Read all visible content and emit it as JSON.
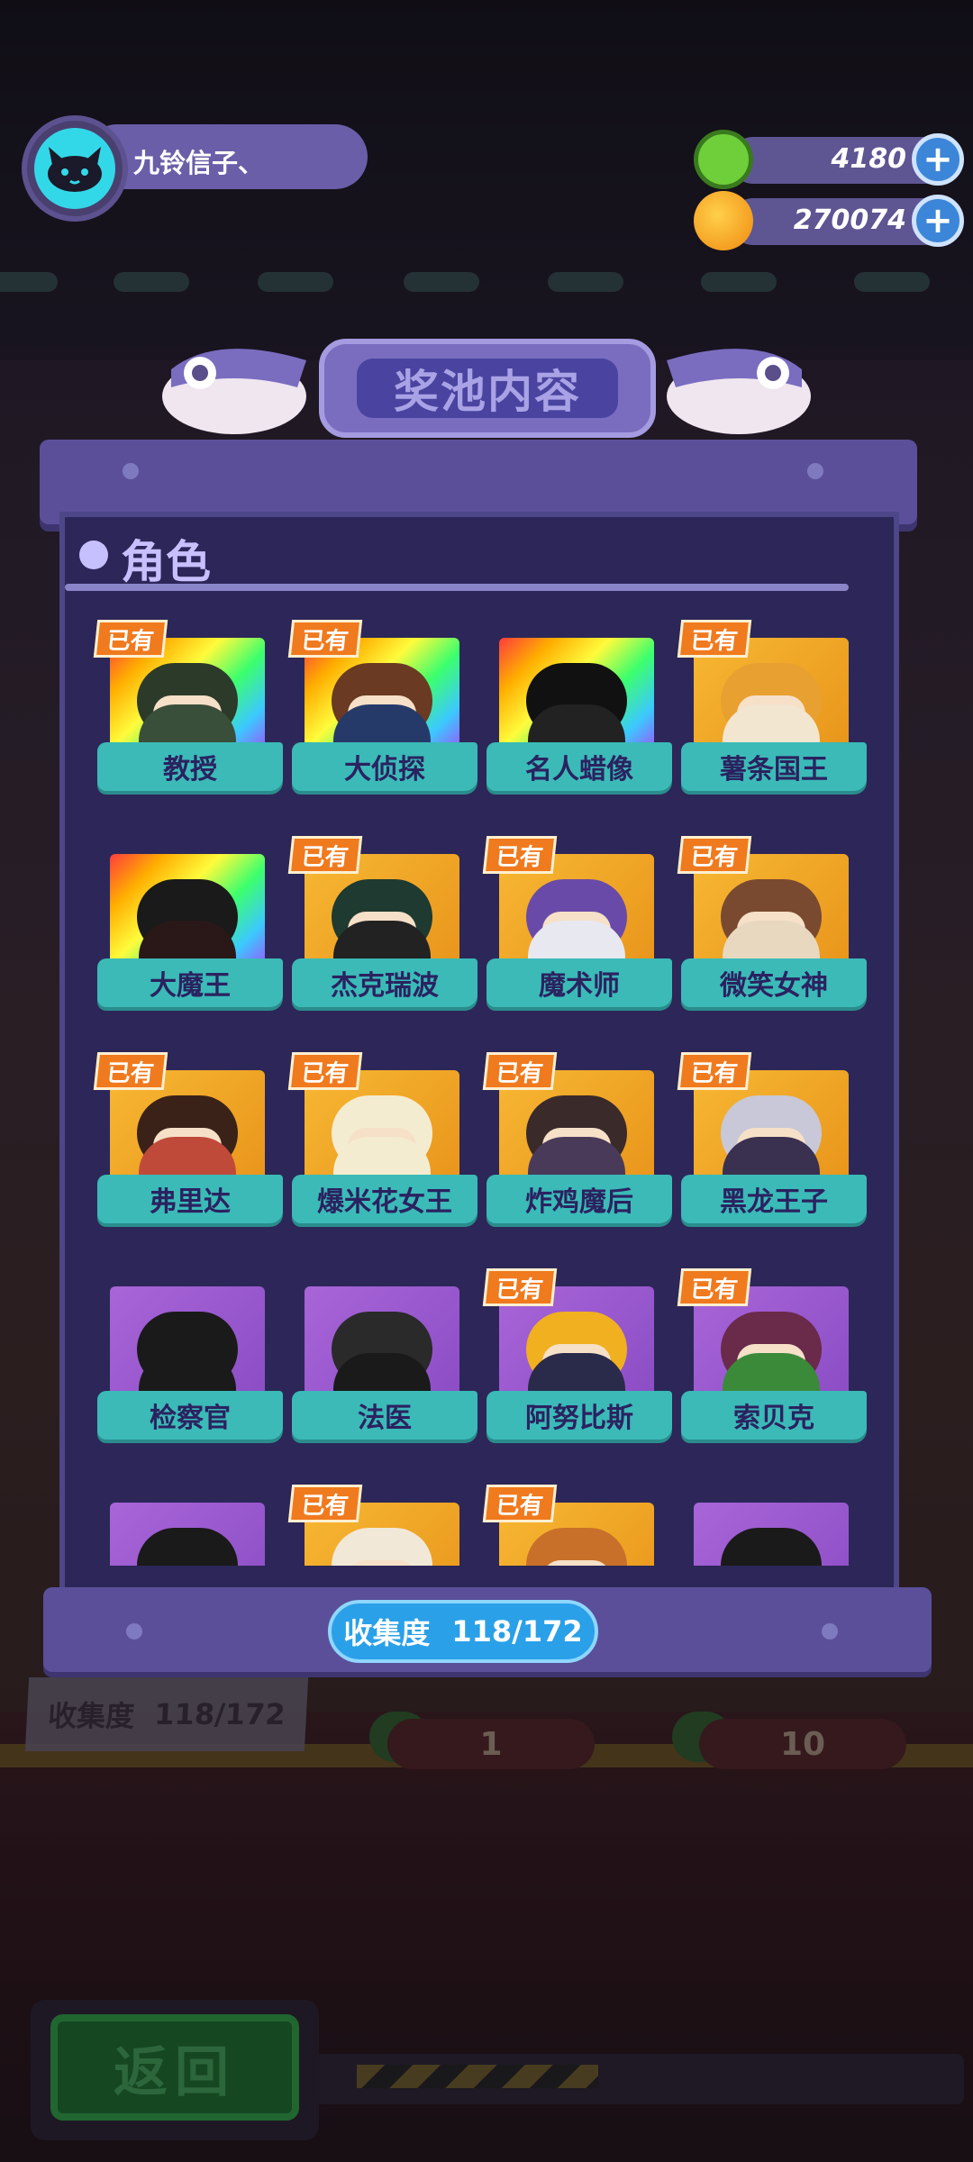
{
  "profile": {
    "username": "九铃信子、"
  },
  "currencies": [
    {
      "name": "cucumber-coin",
      "value": "4180",
      "icon_color": "#6fcf3a"
    },
    {
      "name": "planet-coin",
      "value": "270074",
      "icon_color": "#f7a21a"
    }
  ],
  "panel": {
    "title": "奖池内容",
    "section_title": "角色",
    "owned_label": "已有",
    "collection_label": "收集度",
    "collection_value": "118/172"
  },
  "characters": [
    {
      "name": "教授",
      "owned": true,
      "frame": "rainbow",
      "hair": "#2c3a2a",
      "body": "#3a4f3a"
    },
    {
      "name": "大侦探",
      "owned": true,
      "frame": "rainbow",
      "hair": "#6a3a22",
      "body": "#263a6a"
    },
    {
      "name": "名人蜡像",
      "owned": false,
      "frame": "rainbow",
      "hair": "#111111",
      "body": "#222222"
    },
    {
      "name": "薯条国王",
      "owned": true,
      "frame": "gold",
      "hair": "#e8a030",
      "body": "#f2e6d0"
    },
    {
      "name": "大魔王",
      "owned": false,
      "frame": "rainbow",
      "hair": "#1a1a1a",
      "body": "#2a1818"
    },
    {
      "name": "杰克瑞波",
      "owned": true,
      "frame": "gold",
      "hair": "#1f3a30",
      "body": "#222222"
    },
    {
      "name": "魔术师",
      "owned": true,
      "frame": "gold",
      "hair": "#6a4aa8",
      "body": "#e8e8f0"
    },
    {
      "name": "微笑女神",
      "owned": true,
      "frame": "gold",
      "hair": "#7a4a30",
      "body": "#e8d8c0"
    },
    {
      "name": "弗里达",
      "owned": true,
      "frame": "gold",
      "hair": "#3a2218",
      "body": "#c04a3a"
    },
    {
      "name": "爆米花女王",
      "owned": true,
      "frame": "gold",
      "hair": "#f4ecd0",
      "body": "#f4ecd0"
    },
    {
      "name": "炸鸡魔后",
      "owned": true,
      "frame": "gold",
      "hair": "#3a2a2a",
      "body": "#4a3a5a"
    },
    {
      "name": "黑龙王子",
      "owned": true,
      "frame": "gold",
      "hair": "#c8c8d8",
      "body": "#3a3050"
    },
    {
      "name": "检察官",
      "owned": false,
      "frame": "purple",
      "hair": "#1a1a1a",
      "body": "#1a1a1a"
    },
    {
      "name": "法医",
      "owned": false,
      "frame": "purple",
      "hair": "#2a2a2a",
      "body": "#1a1a1a"
    },
    {
      "name": "阿努比斯",
      "owned": true,
      "frame": "purple",
      "hair": "#f0b020",
      "body": "#2a2a4a"
    },
    {
      "name": "索贝克",
      "owned": true,
      "frame": "purple",
      "hair": "#6a2a4a",
      "body": "#3a8a3a"
    },
    {
      "name": "",
      "owned": false,
      "frame": "purple",
      "hair": "#1a1a1a",
      "body": "#1a1a1a"
    },
    {
      "name": "",
      "owned": true,
      "frame": "gold",
      "hair": "#f2e8d8",
      "body": "#f2e8d8"
    },
    {
      "name": "",
      "owned": true,
      "frame": "gold",
      "hair": "#c8702a",
      "body": "#c8702a"
    },
    {
      "name": "",
      "owned": false,
      "frame": "purple",
      "hair": "#1a1a1a",
      "body": "#1a1a1a"
    }
  ],
  "background": {
    "collection_label": "收集度",
    "collection_value": "118/172",
    "draw_once": "1",
    "draw_ten": "10"
  },
  "back_button": {
    "label": "返回"
  },
  "colors": {
    "panel": "#2c2758",
    "label_teal": "#3bbab8",
    "owned_orange": "#f07a1e",
    "badge_blue": "#2aa0e8"
  }
}
